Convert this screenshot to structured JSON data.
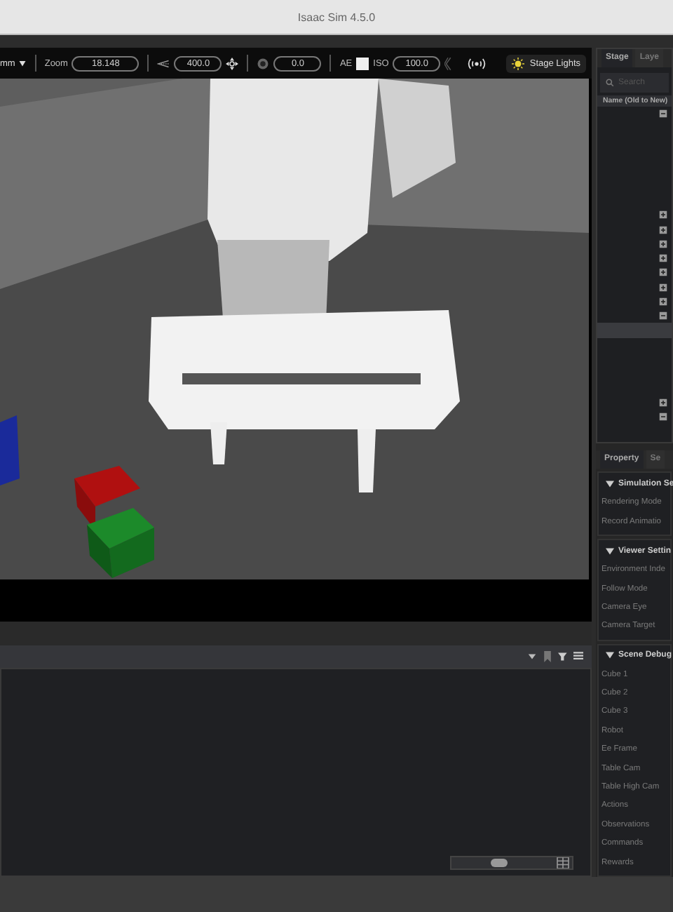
{
  "window": {
    "title": "Isaac Sim 4.5.0"
  },
  "viewport_toolbar": {
    "lens_menu": {
      "label": "mm"
    },
    "zoom": {
      "label": "Zoom",
      "value": "18.148"
    },
    "far_clip": {
      "value": "400.0"
    },
    "exposure": {
      "value": "0.0"
    },
    "auto_exposure": {
      "label": "AE",
      "checked": false
    },
    "iso": {
      "label": "ISO",
      "value": "100.0"
    },
    "lights_button": {
      "label": "Stage Lights"
    }
  },
  "stage_panel": {
    "tabs": [
      {
        "label": "Stage",
        "selected": true
      },
      {
        "label": "Laye",
        "selected": false
      }
    ],
    "search": {
      "placeholder": "Search"
    },
    "column": "Name (Old to New)",
    "tree": [
      {
        "expanded": true,
        "selected": false,
        "children": [
          {
            "selected": false
          },
          {
            "selected": false
          },
          {
            "selected": false
          },
          {
            "selected": false
          },
          {
            "selected": false
          },
          {
            "selected": false
          },
          {
            "expanded": false,
            "selected": false
          },
          {
            "expanded": false,
            "selected": false
          },
          {
            "expanded": false,
            "selected": false
          },
          {
            "expanded": false,
            "selected": false
          },
          {
            "expanded": false,
            "selected": false
          },
          {
            "expanded": false,
            "selected": false
          },
          {
            "expanded": false,
            "selected": false
          },
          {
            "expanded": true,
            "selected": false,
            "children": [
              {
                "selected": true
              },
              {
                "selected": false
              },
              {
                "selected": false
              },
              {
                "selected": false
              },
              {
                "selected": false
              },
              {
                "expanded": false,
                "selected": false
              },
              {
                "expanded": true,
                "selected": false,
                "children": [
                  {
                    "selected": false
                  }
                ]
              }
            ]
          }
        ]
      }
    ]
  },
  "property_panel": {
    "tabs": [
      {
        "label": "Property",
        "selected": true
      },
      {
        "label": "Se",
        "selected": false
      }
    ],
    "sections": [
      {
        "title": "Simulation Se",
        "expanded": true,
        "rows": [
          "Rendering Mode",
          "Record Animatio"
        ]
      },
      {
        "title": "Viewer Settin",
        "expanded": true,
        "rows": [
          "Environment Inde",
          "Follow Mode",
          "Camera Eye",
          "Camera Target"
        ]
      },
      {
        "title": "Scene Debug",
        "expanded": true,
        "rows": [
          "Cube 1",
          "Cube 2",
          "Cube 3",
          "Robot",
          "Ee Frame",
          "Table Cam",
          "Table High Cam",
          "Actions",
          "Observations",
          "Commands",
          "Rewards"
        ]
      }
    ]
  }
}
